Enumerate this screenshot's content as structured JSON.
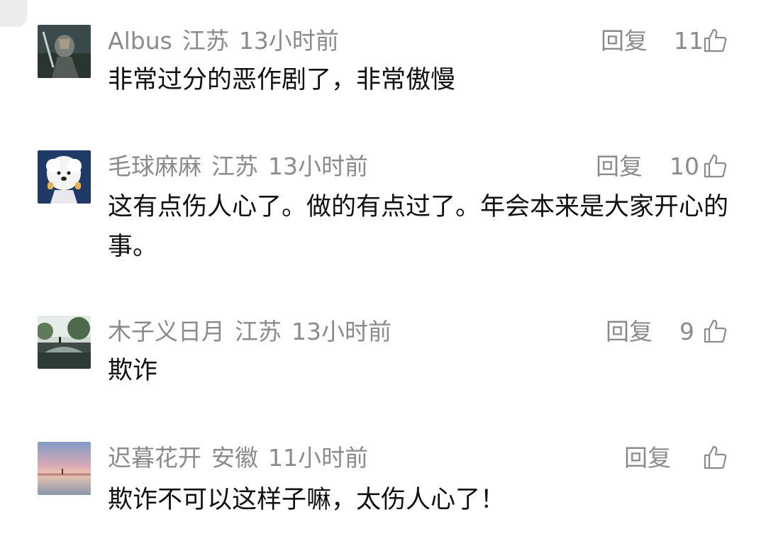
{
  "comments": [
    {
      "username": "Albus",
      "location": "江苏",
      "time": "13小时前",
      "reply_label": "回复",
      "likes": "11",
      "text": "非常过分的恶作剧了，非常傲慢",
      "avatar": "warrior-avatar-icon"
    },
    {
      "username": "毛球麻麻",
      "location": "江苏",
      "time": "13小时前",
      "reply_label": "回复",
      "likes": "10",
      "text": "这有点伤人心了。做的有点过了。年会本来是大家开心的事。",
      "avatar": "white-dog-avatar-icon"
    },
    {
      "username": "木子义日月",
      "location": "江苏",
      "time": "13小时前",
      "reply_label": "回复",
      "likes": "9",
      "text": "欺诈",
      "avatar": "bridge-landscape-avatar-icon"
    },
    {
      "username": "迟暮花开",
      "location": "安徽",
      "time": "11小时前",
      "reply_label": "回复",
      "likes": "",
      "text": "欺诈不可以这样子嘛，太伤人心了！",
      "avatar": "sunset-beach-avatar-icon"
    }
  ],
  "colors": {
    "meta_text": "#8b8b8b",
    "body_text": "#111111"
  }
}
